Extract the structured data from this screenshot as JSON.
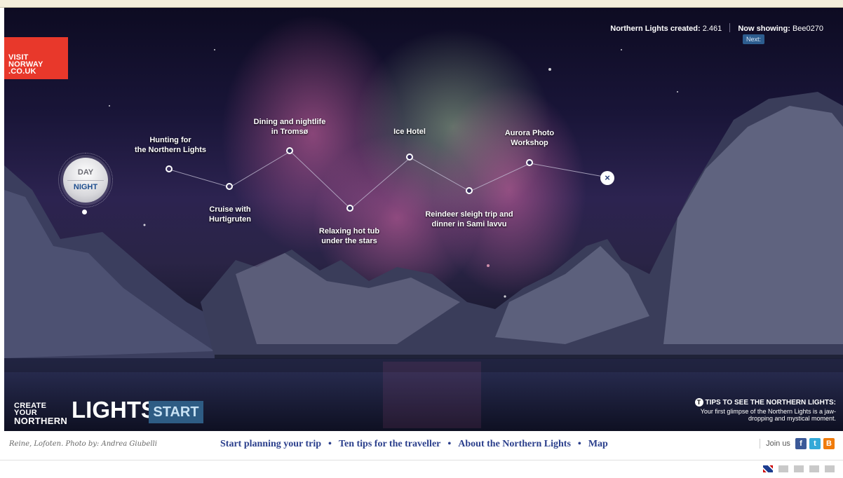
{
  "logo": {
    "lines": [
      "VISIT",
      "NORWAY",
      ".CO.UK"
    ]
  },
  "stats": {
    "created_label": "Northern Lights created:",
    "created_value": "2.461",
    "showing_label": "Now showing:",
    "showing_value": "Bee0270",
    "next_label": "Next:"
  },
  "toggle": {
    "day": "DAY",
    "night": "NIGHT"
  },
  "trip": [
    {
      "label": "Hunting for\nthe Northern Lights"
    },
    {
      "label": "Cruise with\nHurtigruten"
    },
    {
      "label": "Dining and nightlife\nin Tromsø"
    },
    {
      "label": "Relaxing hot tub\nunder the stars"
    },
    {
      "label": "Ice Hotel"
    },
    {
      "label": "Reindeer sleigh trip and\ndinner in Sami lavvu"
    },
    {
      "label": "Aurora Photo\nWorkshop"
    }
  ],
  "close_symbol": "×",
  "create": {
    "line1": "CREATE YOUR",
    "line2": "NORTHERN",
    "big": "LIGHTS",
    "start": "START"
  },
  "tips": {
    "icon": "T",
    "title": "TIPS TO SEE THE NORTHERN LIGHTS:",
    "text": "Your first glimpse of the Northern Lights is a jaw-dropping and mystical moment."
  },
  "footer": {
    "caption": "Reine, Lofoten. Photo by: Andrea Giubelli",
    "links": [
      "Start planning your trip",
      "Ten tips for the traveller",
      "About the Northern Lights",
      "Map"
    ],
    "join": "Join us",
    "social": [
      {
        "icon": "facebook-icon",
        "glyph": "f",
        "color": "#3b5998"
      },
      {
        "icon": "twitter-icon",
        "glyph": "t",
        "color": "#33a9d8"
      },
      {
        "icon": "blogger-icon",
        "glyph": "B",
        "color": "#f07b0c"
      }
    ]
  },
  "tools": [
    "uk-flag-icon",
    "book-icon",
    "print-icon",
    "list-icon",
    "grid-icon"
  ],
  "colors": {
    "logo_red": "#e8382b",
    "link_blue": "#2b3f8c",
    "start_blue": "#2e5c84"
  }
}
